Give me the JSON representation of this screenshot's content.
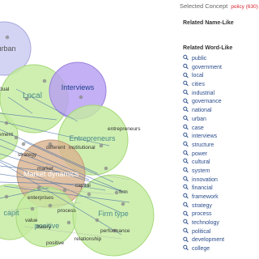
{
  "network": {
    "bubbles": [
      {
        "id": "urban",
        "label": "urban",
        "fill": "#c9c9f0",
        "stroke": "#a9a9dd",
        "label_color": "#555555",
        "label_size": 9
      },
      {
        "id": "local",
        "label": "Local",
        "fill": "#c5eca0",
        "stroke": "#a6d879",
        "label_color": "#4a8a8a",
        "label_size": 10
      },
      {
        "id": "interviews",
        "label": "Interviews",
        "fill": "#b79ff1",
        "stroke": "#9b82de",
        "label_color": "#1f3f8f",
        "label_size": 9
      },
      {
        "id": "entrepreneurs",
        "label": "Entrepreneurs",
        "fill": "#c5eca0",
        "stroke": "#a6d879",
        "label_color": "#4a8a8a",
        "label_size": 9
      },
      {
        "id": "market_dynamics",
        "label": "Market dynamics",
        "fill": "#d9b38f",
        "stroke": "#c49b77",
        "label_color": "#ffffff",
        "label_size": 9
      },
      {
        "id": "firm_type",
        "label": "Firm type",
        "fill": "#c5eca0",
        "stroke": "#a6d879",
        "label_color": "#4a8a8a",
        "label_size": 9
      },
      {
        "id": "left_lower",
        "label": "capit",
        "fill": "#c5eca0",
        "stroke": "#a6d879",
        "label_color": "#4a8a8a",
        "label_size": 9
      },
      {
        "id": "positive_bubble",
        "label": "positive",
        "fill": "#c5eca0",
        "stroke": "#a6d879",
        "label_color": "#4a8a8a",
        "label_size": 9
      },
      {
        "id": "left_top_edge",
        "label": "",
        "fill": "#c5eca0",
        "stroke": "#a6d879",
        "label_color": "#4a8a8a",
        "label_size": 9
      }
    ],
    "nodes": [
      "dual",
      "entrepreneurs",
      "different",
      "institutional",
      "strategy",
      "market",
      "capital",
      "firm",
      "enterprises",
      "value",
      "theory",
      "process",
      "positive",
      "performance",
      "relationship",
      "ement"
    ],
    "colors": {
      "edge": "#4a6fa5",
      "node": "#888888"
    }
  },
  "panel": {
    "selected_label": "Selected Concept",
    "selected_value": "policy (630)",
    "related_name_title": "Related Name-Like",
    "related_word_title": "Related Word-Like",
    "words": [
      "public",
      "government",
      "local",
      "cities",
      "industrial",
      "governance",
      "national",
      "urban",
      "case",
      "interviews",
      "structure",
      "power",
      "cultural",
      "system",
      "innovation",
      "financial",
      "framework",
      "strategy",
      "process",
      "technology",
      "political",
      "development",
      "college"
    ]
  },
  "icons": {
    "search": "search-icon"
  },
  "colors": {
    "link": "#2b4d8c",
    "accent": "#d9232f"
  }
}
